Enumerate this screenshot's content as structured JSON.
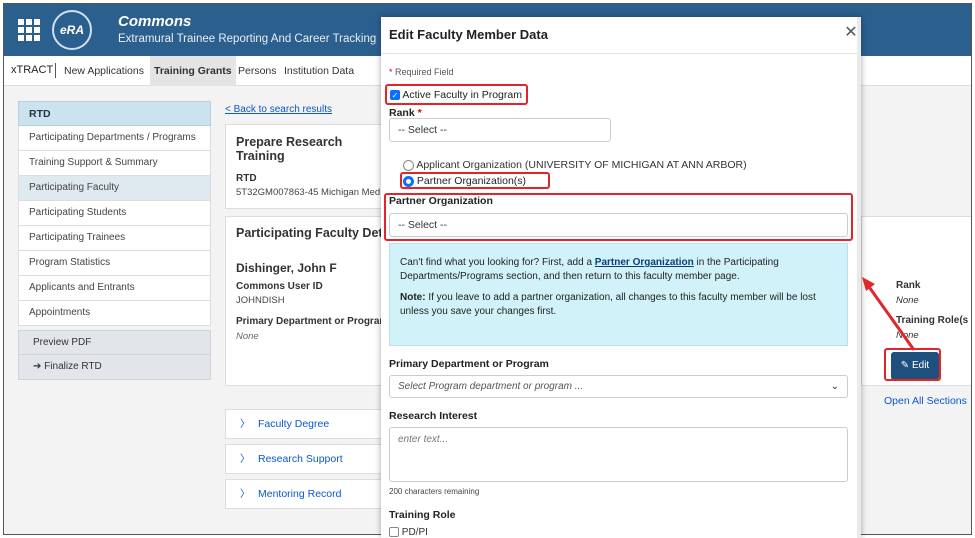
{
  "header": {
    "logo_text": "eRA",
    "title": "Commons",
    "subtitle": "Extramural Trainee Reporting And Career Tracking"
  },
  "nav": {
    "brand": "xTRACT",
    "items": [
      "New Applications",
      "Training Grants",
      "Persons",
      "Institution Data"
    ],
    "active": "Training Grants"
  },
  "sidebar": {
    "head": "RTD",
    "items": [
      "Participating Departments / Programs",
      "Training Support & Summary",
      "Participating Faculty",
      "Participating Students",
      "Participating Trainees",
      "Program Statistics",
      "Applicants and Entrants",
      "Appointments"
    ],
    "active": "Participating Faculty",
    "preview_pdf": "Preview PDF",
    "finalize": "Finalize RTD"
  },
  "main": {
    "back_link": "< Back to search results",
    "prepare_title": "Prepare Research Training",
    "rtd_label": "RTD",
    "rtd_value": "5T32GM007863-45 Michigan Med",
    "faculty_title": "Participating Faculty Detai",
    "person_name": "Dishinger, John F",
    "commons_label": "Commons User ID",
    "commons_value": "JOHNDISH",
    "primary_dept_label": "Primary Department or Program",
    "primary_dept_value": "None",
    "rank_label": "Rank",
    "rank_value": "None",
    "training_role_label": "Training Role(s",
    "training_role_value": "None",
    "edit_button": "Edit",
    "open_all": "Open All Sections",
    "accordions": [
      "Faculty Degree",
      "Research Support",
      "Mentoring Record"
    ]
  },
  "modal": {
    "title": "Edit Faculty Member Data",
    "required_note": "Required Field",
    "active_faculty_label": "Active Faculty in Program",
    "active_faculty_checked": true,
    "rank_label": "Rank",
    "rank_select": "-- Select --",
    "org_option_applicant": "Applicant Organization (UNIVERSITY OF MICHIGAN AT ANN ARBOR)",
    "org_option_partner": "Partner Organization(s)",
    "org_selected": "Partner Organization(s)",
    "partner_org_label": "Partner Organization",
    "partner_org_select": "-- Select --",
    "info_line1_pre": "Can't find what you looking for? First, add a ",
    "info_link": "Partner Organization",
    "info_line1_post": " in the Participating Departments/Programs section, and then return to this faculty member page.",
    "info_note_label": "Note:",
    "info_note_text": " If you leave to add a partner organization, all changes to this faculty member will be lost unless you save your changes first.",
    "primary_dept_label": "Primary Department or Program",
    "primary_dept_placeholder": "Select Program department or program ...",
    "research_label": "Research Interest",
    "research_placeholder": "enter text...",
    "chars_remaining": "200 characters remaining",
    "training_role_label": "Training Role",
    "training_role_option1": "PD/PI"
  },
  "colors": {
    "header_blue": "#2b5f8e",
    "highlight_red": "#e0262b",
    "info_bg": "#d2f2fa",
    "edit_button": "#1e4f7d"
  }
}
